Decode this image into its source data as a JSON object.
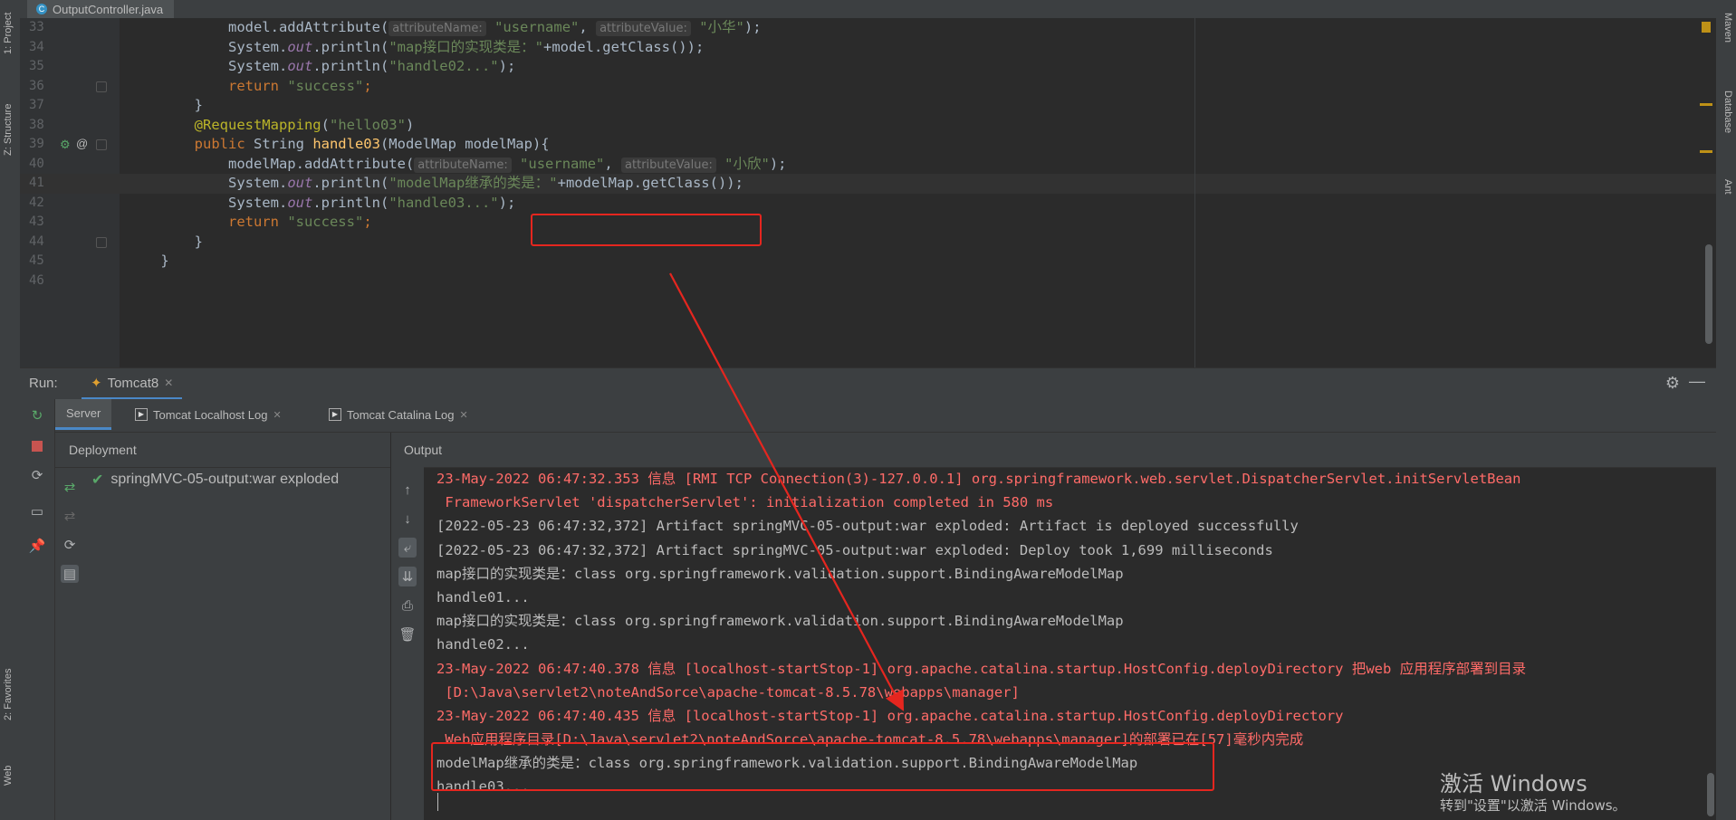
{
  "left_strip": {
    "tabs": [
      "1: Project",
      "Z: Structure",
      "2: Favorites",
      "Web"
    ]
  },
  "right_strip": {
    "tabs": [
      "Maven",
      "Database",
      "Ant"
    ]
  },
  "editor": {
    "file_tab": "OutputController.java",
    "lines": [
      {
        "n": "33",
        "tokens": [
          {
            "t": "            model.addAttribute(",
            "c": "plain"
          },
          {
            "t": "attributeName:",
            "c": "hint"
          },
          {
            "t": " \"username\"",
            "c": "str"
          },
          {
            "t": ", ",
            "c": "plain"
          },
          {
            "t": "attributeValue:",
            "c": "hint"
          },
          {
            "t": " \"小华\"",
            "c": "str"
          },
          {
            "t": ");",
            "c": "plain"
          }
        ]
      },
      {
        "n": "34",
        "tokens": [
          {
            "t": "            System.",
            "c": "plain"
          },
          {
            "t": "out",
            "c": "fld"
          },
          {
            "t": ".println(",
            "c": "plain"
          },
          {
            "t": "\"map接口的实现类是：\"",
            "c": "str"
          },
          {
            "t": "+model.getClass());",
            "c": "plain"
          }
        ]
      },
      {
        "n": "35",
        "tokens": [
          {
            "t": "            System.",
            "c": "plain"
          },
          {
            "t": "out",
            "c": "fld"
          },
          {
            "t": ".println(",
            "c": "plain"
          },
          {
            "t": "\"handle02...\"",
            "c": "str"
          },
          {
            "t": ");",
            "c": "plain"
          }
        ]
      },
      {
        "n": "36",
        "tokens": [
          {
            "t": "            ",
            "c": "plain"
          },
          {
            "t": "return",
            "c": "kw"
          },
          {
            "t": " \"success\"",
            "c": "str"
          },
          {
            "t": ";",
            "c": "kw"
          }
        ]
      },
      {
        "n": "37",
        "tokens": [
          {
            "t": "        }",
            "c": "plain"
          }
        ]
      },
      {
        "n": "38",
        "tokens": [
          {
            "t": "        ",
            "c": "plain"
          },
          {
            "t": "@RequestMapping",
            "c": "ann"
          },
          {
            "t": "(",
            "c": "plain"
          },
          {
            "t": "\"hello03\"",
            "c": "str"
          },
          {
            "t": ")",
            "c": "plain"
          }
        ]
      },
      {
        "n": "39",
        "tokens": [
          {
            "t": "        ",
            "c": "plain"
          },
          {
            "t": "public",
            "c": "kw"
          },
          {
            "t": " String ",
            "c": "plain"
          },
          {
            "t": "handle03",
            "c": "fn"
          },
          {
            "t": "(ModelMap modelMap){",
            "c": "plain"
          }
        ]
      },
      {
        "n": "40",
        "tokens": [
          {
            "t": "            modelMap.addAttribute(",
            "c": "plain"
          },
          {
            "t": "attributeName:",
            "c": "hint"
          },
          {
            "t": " \"username\"",
            "c": "str"
          },
          {
            "t": ", ",
            "c": "plain"
          },
          {
            "t": "attributeValue:",
            "c": "hint"
          },
          {
            "t": " \"小欣\"",
            "c": "str"
          },
          {
            "t": ");",
            "c": "plain"
          }
        ]
      },
      {
        "n": "41",
        "tokens": [
          {
            "t": "            System.",
            "c": "plain"
          },
          {
            "t": "out",
            "c": "fld"
          },
          {
            "t": ".println(",
            "c": "plain"
          },
          {
            "t": "\"modelMap继承的类是：\"",
            "c": "str"
          },
          {
            "t": "+modelMap.getClass());",
            "c": "plain"
          }
        ]
      },
      {
        "n": "42",
        "tokens": [
          {
            "t": "            System.",
            "c": "plain"
          },
          {
            "t": "out",
            "c": "fld"
          },
          {
            "t": ".println(",
            "c": "plain"
          },
          {
            "t": "\"handle03...\"",
            "c": "str"
          },
          {
            "t": ");",
            "c": "plain"
          }
        ]
      },
      {
        "n": "43",
        "tokens": [
          {
            "t": "            ",
            "c": "plain"
          },
          {
            "t": "return",
            "c": "kw"
          },
          {
            "t": " \"success\"",
            "c": "str"
          },
          {
            "t": ";",
            "c": "kw"
          }
        ]
      },
      {
        "n": "44",
        "tokens": [
          {
            "t": "        }",
            "c": "plain"
          }
        ]
      },
      {
        "n": "45",
        "tokens": [
          {
            "t": "    }",
            "c": "plain"
          }
        ]
      },
      {
        "n": "46",
        "tokens": []
      }
    ],
    "current_line": "41"
  },
  "run": {
    "label": "Run:",
    "tab": "Tomcat8",
    "service_tabs": [
      "Server",
      "Tomcat Localhost Log",
      "Tomcat Catalina Log"
    ],
    "deployment_header": "Deployment",
    "deployment_item": "springMVC-05-output:war exploded",
    "output_header": "Output",
    "log": [
      {
        "t": "23-May-2022 06:47:32.353 信息 [RMI TCP Connection(3)-127.0.0.1] org.springframework.web.servlet.DispatcherServlet.initServletBean",
        "c": "err"
      },
      {
        "t": " FrameworkServlet 'dispatcherServlet': initialization completed in 580 ms",
        "c": "err"
      },
      {
        "t": "[2022-05-23 06:47:32,372] Artifact springMVC-05-output:war exploded: Artifact is deployed successfully",
        "c": "info"
      },
      {
        "t": "[2022-05-23 06:47:32,372] Artifact springMVC-05-output:war exploded: Deploy took 1,699 milliseconds",
        "c": "info"
      },
      {
        "t": "map接口的实现类是：class org.springframework.validation.support.BindingAwareModelMap",
        "c": "info"
      },
      {
        "t": "handle01...",
        "c": "info"
      },
      {
        "t": "map接口的实现类是：class org.springframework.validation.support.BindingAwareModelMap",
        "c": "info"
      },
      {
        "t": "handle02...",
        "c": "info"
      },
      {
        "t": "23-May-2022 06:47:40.378 信息 [localhost-startStop-1] org.apache.catalina.startup.HostConfig.deployDirectory 把web 应用程序部署到目录",
        "c": "err"
      },
      {
        "t": " [D:\\Java\\servlet2\\noteAndSorce\\apache-tomcat-8.5.78\\webapps\\manager]",
        "c": "err"
      },
      {
        "t": "23-May-2022 06:47:40.435 信息 [localhost-startStop-1] org.apache.catalina.startup.HostConfig.deployDirectory",
        "c": "err"
      },
      {
        "t": " Web应用程序目录[D:\\Java\\servlet2\\noteAndSorce\\apache-tomcat-8.5.78\\webapps\\manager]的部署已在[57]毫秒内完成",
        "c": "err"
      },
      {
        "t": "modelMap继承的类是：class org.springframework.validation.support.BindingAwareModelMap",
        "c": "info"
      },
      {
        "t": "handle03...",
        "c": "info"
      }
    ]
  },
  "watermark": {
    "title": "激活 Windows",
    "subtitle": "转到\"设置\"以激活 Windows。"
  },
  "colors": {
    "annotation_red": "#e5261f",
    "accent_blue": "#4a88c7"
  }
}
